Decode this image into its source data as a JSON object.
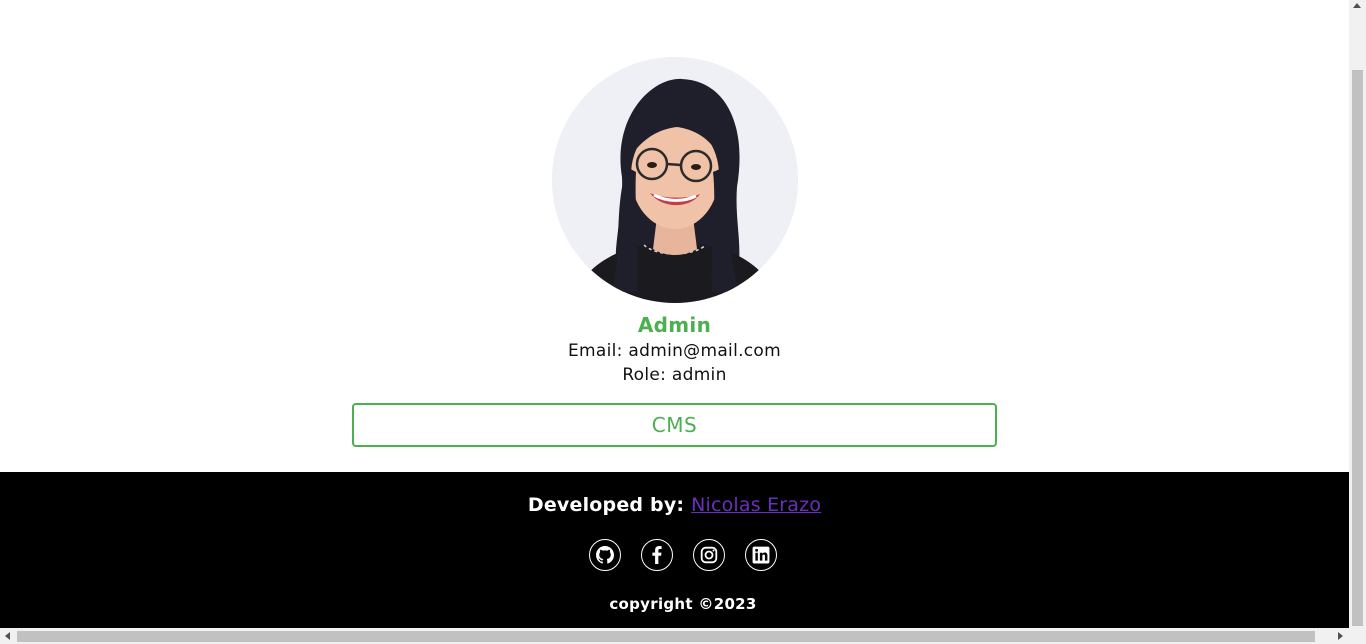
{
  "profile": {
    "avatar_alt": "profile photo",
    "name": "Admin",
    "email_text": "Email: admin@mail.com",
    "role_text": "Role: admin",
    "cms_button_label": "CMS"
  },
  "footer": {
    "developed_by_label": "Developed by:",
    "developer_name": "Nicolas Erazo",
    "socials": [
      {
        "icon": "github-icon"
      },
      {
        "icon": "facebook-icon"
      },
      {
        "icon": "instagram-icon"
      },
      {
        "icon": "linkedin-icon"
      }
    ],
    "copyright_text": "copyright ©2023"
  },
  "colors": {
    "accent": "#4caf50",
    "link": "#6a2ebd",
    "footer_bg": "#000000"
  }
}
